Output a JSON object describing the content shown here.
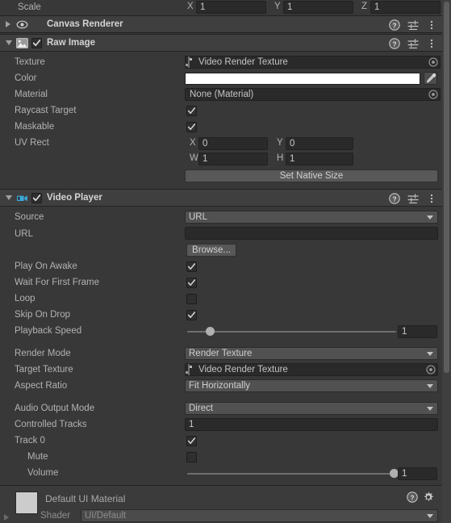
{
  "transform_tail": {
    "label": "Scale",
    "axes": [
      {
        "axis": "X",
        "value": "1"
      },
      {
        "axis": "Y",
        "value": "1"
      },
      {
        "axis": "Z",
        "value": "1"
      }
    ]
  },
  "components": [
    {
      "name": "canvas-renderer",
      "title": "Canvas Renderer",
      "expanded": false,
      "icon": "eye-icon",
      "has_enable_toggle": false,
      "header_icons": [
        "help-icon",
        "preset-icon",
        "menu-icon"
      ]
    },
    {
      "name": "raw-image",
      "title": "Raw Image",
      "expanded": true,
      "icon": "image-icon",
      "has_enable_toggle": true,
      "enabled": true,
      "header_icons": [
        "help-icon",
        "preset-icon",
        "menu-icon"
      ]
    },
    {
      "name": "video-player",
      "title": "Video Player",
      "expanded": true,
      "icon": "video-icon",
      "has_enable_toggle": true,
      "enabled": true,
      "header_icons": [
        "help-icon",
        "preset-icon",
        "menu-icon"
      ]
    }
  ],
  "raw_image": {
    "texture": {
      "label": "Texture",
      "value": "Video Render Texture",
      "icon": "render-texture-icon"
    },
    "color": {
      "label": "Color",
      "value": "#FFFFFF",
      "eyedropper": "eyedropper-icon"
    },
    "material": {
      "label": "Material",
      "value": "None (Material)"
    },
    "raycast_target": {
      "label": "Raycast Target",
      "checked": true
    },
    "maskable": {
      "label": "Maskable",
      "checked": true
    },
    "uv_rect": {
      "label": "UV Rect",
      "fields": [
        {
          "axis": "X",
          "value": "0"
        },
        {
          "axis": "Y",
          "value": "0"
        },
        {
          "axis": "W",
          "value": "1"
        },
        {
          "axis": "H",
          "value": "1"
        }
      ]
    },
    "set_native_size": "Set Native Size"
  },
  "video_player": {
    "source": {
      "label": "Source",
      "value": "URL"
    },
    "url": {
      "label": "URL",
      "value": "",
      "placeholder": ""
    },
    "browse": "Browse...",
    "play_on_awake": {
      "label": "Play On Awake",
      "checked": true
    },
    "wait_for_first_frame": {
      "label": "Wait For First Frame",
      "checked": true
    },
    "loop": {
      "label": "Loop",
      "checked": false
    },
    "skip_on_drop": {
      "label": "Skip On Drop",
      "checked": true
    },
    "playback_speed": {
      "label": "Playback Speed",
      "value": "1",
      "fill_percent": 25
    },
    "render_mode": {
      "label": "Render Mode",
      "value": "Render Texture"
    },
    "target_texture": {
      "label": "Target Texture",
      "value": "Video Render Texture",
      "icon": "render-texture-icon"
    },
    "aspect_ratio": {
      "label": "Aspect Ratio",
      "value": "Fit Horizontally"
    },
    "audio_output_mode": {
      "label": "Audio Output Mode",
      "value": "Direct"
    },
    "controlled_tracks": {
      "label": "Controlled Tracks",
      "value": "1"
    },
    "track_0": {
      "label": "Track 0",
      "checked": true
    },
    "mute": {
      "label": "Mute",
      "checked": false
    },
    "volume": {
      "label": "Volume",
      "value": "1",
      "fill_percent": 100
    }
  },
  "material_footer": {
    "name": "Default UI Material",
    "shader_label": "Shader",
    "shader_value": "UI/Default",
    "header_icons": [
      "help-icon",
      "gear-icon"
    ]
  },
  "colors": {
    "panel_bg": "#383838",
    "header_bg": "#3f3f3f",
    "field_bg": "#2a2a2a",
    "dropdown_bg": "#515151",
    "button_bg": "#585858",
    "text": "#b2b2b2",
    "title_text": "#d4d4d4",
    "accent_video_icon": "#3ba7d8",
    "color_swatch": "#FFFFFF"
  }
}
